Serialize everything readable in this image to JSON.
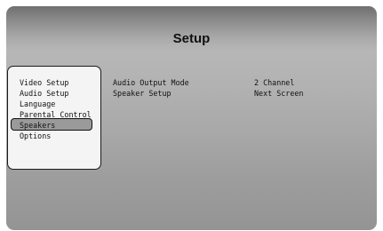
{
  "title": "Setup",
  "menu": {
    "items": [
      {
        "label": "Video Setup"
      },
      {
        "label": "Audio Setup"
      },
      {
        "label": "Language"
      },
      {
        "label": "Parental Control"
      },
      {
        "label": "Speakers"
      },
      {
        "label": "Options"
      }
    ],
    "selected": "Speakers"
  },
  "settings": [
    {
      "label": "Audio Output Mode",
      "value": "2 Channel"
    },
    {
      "label": "Speaker Setup",
      "value": "Next Screen"
    }
  ]
}
